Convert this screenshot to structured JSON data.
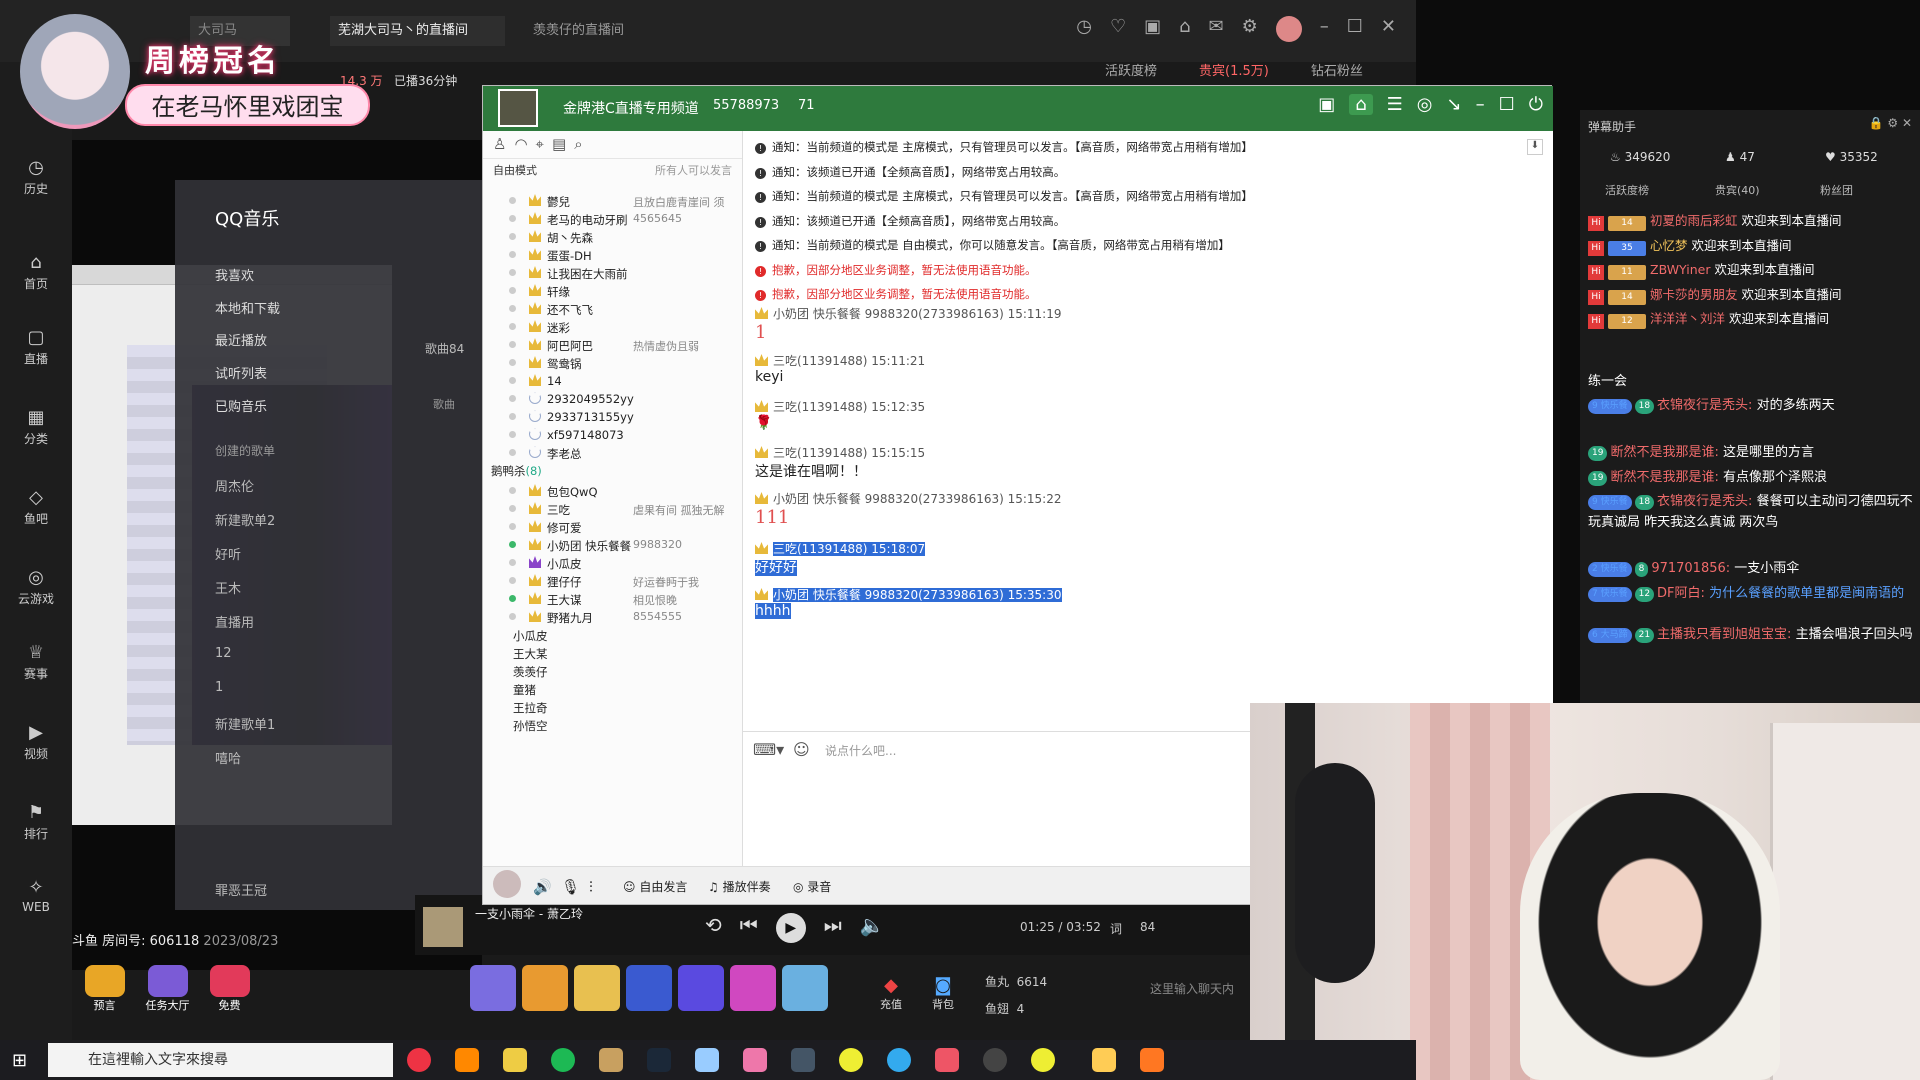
{
  "douyu": {
    "tabs": [
      "芜湖大司马丶的直播间",
      "羡羡仔的直播间"
    ],
    "search_placeholder": "大司马",
    "room_label": "斗鱼 房间号: 606118",
    "room_date": "2023/08/23",
    "stats_fans": "14.3 万",
    "stats_time": "已播36分钟",
    "rank_tabs": [
      "活跃度榜",
      "贵宾(1.5万)",
      "钻石粉丝"
    ],
    "side_nav": [
      "历史",
      "首页",
      "直播",
      "分类",
      "鱼吧",
      "云游戏",
      "赛事",
      "视频",
      "排行",
      "WEB"
    ],
    "banner_title": "周榜冠名",
    "banner_sub": "在老马怀里戏团宝",
    "left_buttons": [
      "预言",
      "任务大厅",
      "免费"
    ],
    "fishball_label": "鱼丸",
    "fishball": "6614",
    "fishwing_label": "鱼翅",
    "fishwing": "4",
    "chat_placeholder": "这里输入聊天内",
    "recharge": "充值",
    "backpack": "背包"
  },
  "qqmusic": {
    "logo": "QQ音乐",
    "menu": [
      "我喜欢",
      "本地和下载",
      "最近播放",
      "试听列表",
      "已购音乐"
    ],
    "created_header": "创建的歌单",
    "playlists": [
      "周杰伦",
      "新建歌单2",
      "好听",
      "王木",
      "直播用",
      "12",
      "1",
      "新建歌单1",
      "嘻哈",
      "罪恶王冠"
    ],
    "song_title": "一支小雨伞 - 萧乙玲",
    "time": "01:25 / 03:52",
    "count": "84",
    "lyrics_label": "词",
    "list_count": "歌曲84",
    "list_sort": "歌曲"
  },
  "yy": {
    "channel_name": "金牌港C直播专用频道",
    "channel_id": "55788973",
    "online": "71",
    "mode": "自由模式",
    "mode_right": "所有人可以发言",
    "users": [
      {
        "name": "鬱兒",
        "sig": "且放白鹿青崖间 须",
        "on": false,
        "crown": "gold"
      },
      {
        "name": "老马的电动牙刷",
        "sig": "4565645",
        "on": false,
        "crown": "gold"
      },
      {
        "name": "胡丶先森",
        "sig": "",
        "on": false,
        "crown": "gold"
      },
      {
        "name": "蛋蛋-DH",
        "sig": "",
        "on": false,
        "crown": "gold"
      },
      {
        "name": "让我困在大雨前",
        "sig": "",
        "on": false,
        "crown": "gold"
      },
      {
        "name": "轩缘",
        "sig": "",
        "on": false,
        "crown": "gold"
      },
      {
        "name": "还不飞飞",
        "sig": "",
        "on": false,
        "crown": "gold"
      },
      {
        "name": "迷彩",
        "sig": "",
        "on": false,
        "crown": "gold"
      },
      {
        "name": "阿巴阿巴",
        "sig": "热情虚伪且弱",
        "on": false,
        "crown": "gold"
      },
      {
        "name": "鸳鸯锅",
        "sig": "",
        "on": false,
        "crown": "gold"
      },
      {
        "name": "14",
        "sig": "",
        "on": false,
        "crown": "gold"
      },
      {
        "name": "2932049552yy",
        "sig": "",
        "on": false,
        "crown": "star"
      },
      {
        "name": "2933713155yy",
        "sig": "",
        "on": false,
        "crown": "star"
      },
      {
        "name": "xf597148073",
        "sig": "",
        "on": false,
        "crown": "star"
      },
      {
        "name": "李老总",
        "sig": "",
        "on": false,
        "crown": "star"
      }
    ],
    "group_name": "鹅鸭杀",
    "group_count": "(8)",
    "group_users": [
      {
        "name": "包包QwQ",
        "sig": "",
        "on": false,
        "crown": "gold"
      },
      {
        "name": "三吃",
        "sig": "虐果有间 孤独无解",
        "on": false,
        "crown": "gold"
      },
      {
        "name": "修可爱",
        "sig": "",
        "on": false,
        "crown": "gold"
      },
      {
        "name": "小奶团 快乐餐餐",
        "sig": "9988320",
        "on": true,
        "crown": "gold"
      },
      {
        "name": "小瓜皮",
        "sig": "",
        "on": false,
        "crown": "purple"
      },
      {
        "name": "狸仔仔",
        "sig": "好运眷眄于我",
        "on": false,
        "crown": "gold"
      },
      {
        "name": "王大谋",
        "sig": "相见恨晚",
        "on": true,
        "crown": "gold"
      },
      {
        "name": "野猪九月",
        "sig": "8554555",
        "on": false,
        "crown": "gold"
      }
    ],
    "sub_channels": [
      "小瓜皮",
      "王大某",
      "羡羡仔",
      "童猪",
      "王拉奇",
      "孙悟空"
    ],
    "system_msgs": [
      {
        "text": "通知：当前频道的模式是 主席模式，只有管理员可以发言。【高音质，网络带宽占用稍有增加】",
        "red": false
      },
      {
        "text": "通知：该频道已开通【全频高音质】，网络带宽占用较高。",
        "red": false
      },
      {
        "text": "通知：当前频道的模式是 主席模式，只有管理员可以发言。【高音质，网络带宽占用稍有增加】",
        "red": false
      },
      {
        "text": "通知：该频道已开通【全频高音质】，网络带宽占用较高。",
        "red": false
      },
      {
        "text": "通知：当前频道的模式是 自由模式，你可以随意发言。【高音质，网络带宽占用稍有增加】",
        "red": false
      },
      {
        "text": "抱歉，因部分地区业务调整，暂无法使用语音功能。",
        "red": true
      },
      {
        "text": "抱歉，因部分地区业务调整，暂无法使用语音功能。",
        "red": true
      }
    ],
    "messages": [
      {
        "head": "小奶团 快乐餐餐 9988320(2733986163)  15:11:19",
        "body": "1",
        "red": true,
        "sel": false
      },
      {
        "head": "三吃(11391488)  15:11:21",
        "body": "keyi",
        "red": false,
        "sel": false
      },
      {
        "head": "三吃(11391488)  15:12:35",
        "body": "🌹",
        "red": false,
        "sel": false
      },
      {
        "head": "三吃(11391488)  15:15:15",
        "body": "这是谁在唱啊！！",
        "red": false,
        "sel": false
      },
      {
        "head": "小奶团 快乐餐餐 9988320(2733986163)  15:15:22",
        "body": "111",
        "red": true,
        "sel": false
      },
      {
        "head": "三吃(11391488)  15:18:07",
        "body": "好好好",
        "red": false,
        "sel": true
      },
      {
        "head": "小奶团 快乐餐餐 9988320(2733986163)  15:35:30",
        "body": "hhhh",
        "red": false,
        "sel": true
      }
    ],
    "input_placeholder": "说点什么吧...",
    "bottom_buttons": [
      "自由发言",
      "播放伴奏",
      "录音"
    ]
  },
  "danmu": {
    "title": "弹幕助手",
    "stat_hot": "349620",
    "stat_fans": "47",
    "stat_likes": "35352",
    "tabs": [
      "活跃度榜",
      "贵宾(40)",
      "粉丝团"
    ],
    "enters": [
      {
        "lv": "14",
        "name": "初夏的雨后彩虹",
        "text": "欢迎来到本直播间",
        "blue": false,
        "yl": false
      },
      {
        "lv": "35",
        "name": "心忆梦",
        "text": "欢迎来到本直播间",
        "blue": true,
        "yl": true
      },
      {
        "lv": "11",
        "name": "ZBWYiner",
        "text": "欢迎来到本直播间",
        "blue": false,
        "yl": false
      },
      {
        "lv": "14",
        "name": "娜卡莎的男朋友",
        "text": "欢迎来到本直播间",
        "blue": false,
        "yl": false
      },
      {
        "lv": "12",
        "name": "洋洋洋丶刘洋",
        "text": "欢迎来到本直播间",
        "blue": false,
        "yl": false
      }
    ],
    "section": "练一会",
    "chats": [
      {
        "tag": "9 快乐餐",
        "lv": "18",
        "name": "衣锦夜行是秃头:",
        "text": "对的多练两天"
      },
      {
        "tag": "",
        "lv": "19",
        "name": "断然不是我那是谁:",
        "text": "这是哪里的方言"
      },
      {
        "tag": "",
        "lv": "19",
        "name": "断然不是我那是谁:",
        "text": "有点像那个泽熙浪"
      },
      {
        "tag": "9 快乐餐",
        "lv": "18",
        "name": "衣锦夜行是秃头:",
        "text": "餐餐可以主动问刁德四玩不玩真诚局 昨天我这么真诚 两次鸟"
      },
      {
        "tag": "2 快乐餐",
        "lv": "8",
        "name": "971701856:",
        "text": "一支小雨伞"
      },
      {
        "tag": "7 快乐餐",
        "lv": "12",
        "name": "DF阿白:",
        "text": "为什么餐餐的歌单里都是闽南语的"
      },
      {
        "tag": "6 大马蹄",
        "lv": "21",
        "name": "主播我只看到旭姐宝宝:",
        "text": "主播会唱浪子回头吗"
      }
    ]
  },
  "taskbar": {
    "search_placeholder": "在這裡輸入文字來搜尋"
  }
}
